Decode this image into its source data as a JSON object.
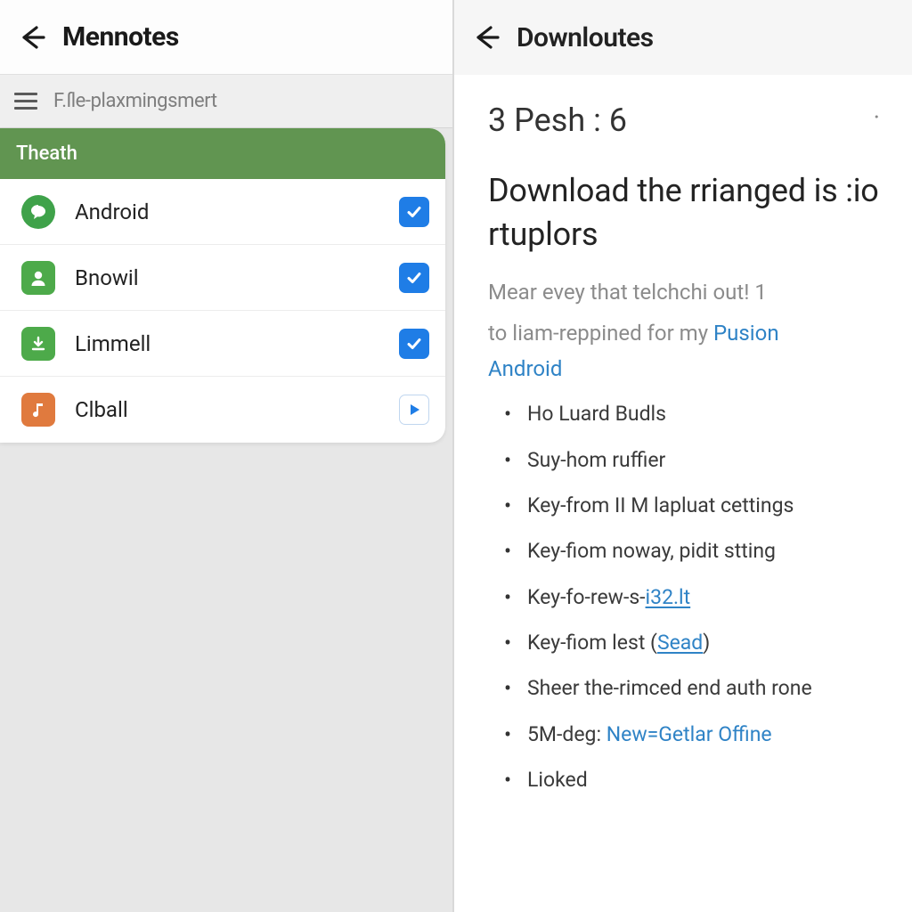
{
  "left": {
    "title": "Mennotes",
    "search_placeholder": "F.ſle-plaxmingsmert",
    "section_header": "Theath",
    "items": [
      {
        "icon": "chat-bubble",
        "color": "green-circle",
        "label": "Android",
        "trailing": "check"
      },
      {
        "icon": "person",
        "color": "green-sq",
        "label": "Bnowil",
        "trailing": "check"
      },
      {
        "icon": "download",
        "color": "green-dl",
        "label": "Limmell",
        "trailing": "check"
      },
      {
        "icon": "music-note",
        "color": "orange-sq",
        "label": "Clball",
        "trailing": "play"
      }
    ]
  },
  "right": {
    "title": "Downloutes",
    "pesh_line": "3 Pesh : 6",
    "heading": "Download the rrianged is :io rtuplors",
    "subtext_1": "Mear evey that telchchi out! 1",
    "subtext_2_pre": "to liam-reppined for my ",
    "subtext_2_link": "Pusion",
    "android_link": "Android",
    "bullets": [
      {
        "text": "Ho Luard Budls"
      },
      {
        "text": "Suy-hom ruffier"
      },
      {
        "text": "Key-from II M lapluat cettings"
      },
      {
        "text": "Key-fiom noway, pidit stting"
      },
      {
        "text_pre": "Key-fo-rew-s-",
        "link": "i32.lt",
        "link_style": "u"
      },
      {
        "text_pre": "Key-fiom lest (",
        "link": "Sead",
        "link_style": "u",
        "text_post": ")"
      },
      {
        "text": "Sheer the-rimced end auth rone"
      },
      {
        "text_pre": "5M-deg:  ",
        "link": "New=Getlar Offine",
        "link_style": "plain"
      },
      {
        "text": "Lioked"
      }
    ]
  }
}
